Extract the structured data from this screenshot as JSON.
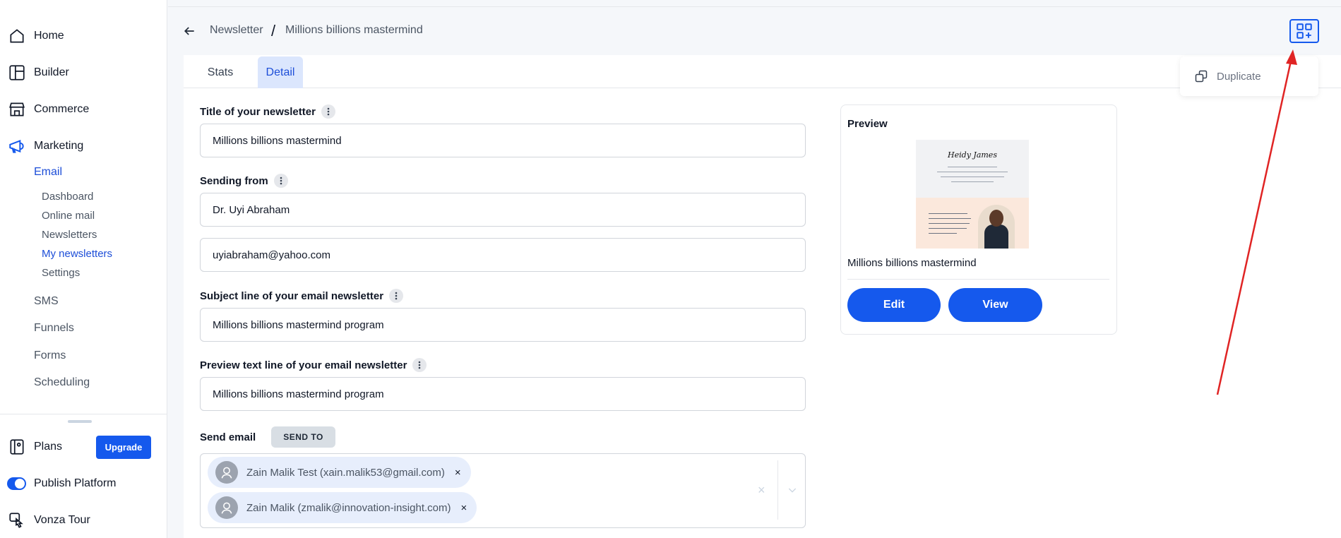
{
  "colors": {
    "primary": "#1559ed",
    "active_text": "#1d4ed8",
    "tab_active_bg": "#dbe6fd",
    "annotation_arrow": "#e02424"
  },
  "sidebar": {
    "items": [
      {
        "label": "Home",
        "icon": "home-icon"
      },
      {
        "label": "Builder",
        "icon": "builder-icon"
      },
      {
        "label": "Commerce",
        "icon": "store-icon"
      },
      {
        "label": "Marketing",
        "icon": "megaphone-icon"
      }
    ],
    "marketing": {
      "email_label": "Email",
      "email_sub": [
        "Dashboard",
        "Online mail",
        "Newsletters",
        "My newsletters",
        "Settings"
      ],
      "active_sub": "My newsletters",
      "other": [
        "SMS",
        "Funnels",
        "Forms",
        "Scheduling"
      ]
    },
    "bottom": {
      "plans_label": "Plans",
      "upgrade_label": "Upgrade",
      "publish_label": "Publish Platform",
      "tour_label": "Vonza Tour"
    }
  },
  "breadcrumb": {
    "parent": "Newsletter",
    "separator": "/",
    "current": "Millions billions mastermind"
  },
  "tabs": [
    {
      "label": "Stats"
    },
    {
      "label": "Detail",
      "active": true
    }
  ],
  "form": {
    "title_label": "Title of your newsletter",
    "title_value": "Millions billions mastermind",
    "sending_from_label": "Sending from",
    "sender_name": "Dr. Uyi Abraham",
    "sender_email": "uyiabraham@yahoo.com",
    "subject_label": "Subject line of your email newsletter",
    "subject_value": "Millions billions mastermind program",
    "preview_text_label": "Preview text line of your email newsletter",
    "preview_text_value": "Millions billions mastermind program",
    "send_email_label": "Send email",
    "send_to_label": "SEND TO",
    "recipients": [
      {
        "name": "Zain Malik Test (xain.malik53@gmail.com)"
      },
      {
        "name": "Zain Malik (zmalik@innovation-insight.com)"
      }
    ],
    "chip_remove": "×",
    "clear_all": "×"
  },
  "preview": {
    "title": "Preview",
    "thumb_signature": "Heidy James",
    "name": "Millions billions mastermind",
    "edit_label": "Edit",
    "view_label": "View"
  },
  "actions": {
    "duplicate_label": "Duplicate"
  }
}
